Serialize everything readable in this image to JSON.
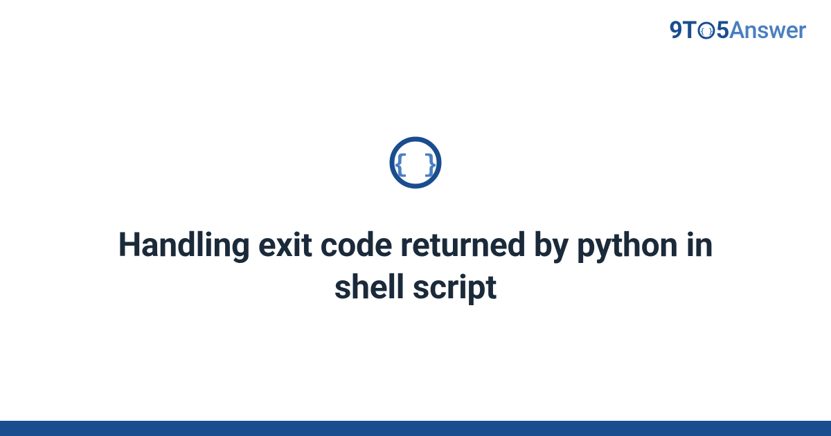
{
  "brand": {
    "prefix": "9T",
    "middle_glyph": "{ }",
    "suffix": "5",
    "word": "Answer"
  },
  "main": {
    "title": "Handling exit code returned by python in shell script",
    "icon_glyph": "{ }"
  },
  "colors": {
    "brand_dark": "#1a4d8f",
    "brand_light": "#4a7fc1",
    "title_color": "#1b2a3a"
  }
}
